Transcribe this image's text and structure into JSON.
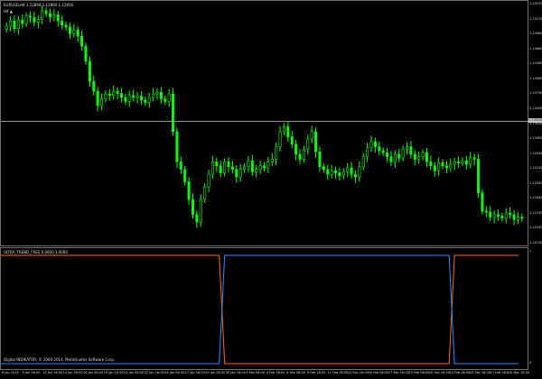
{
  "header": {
    "symbol_line": "EURUSD,H4  1.12894 1.12894 1.12856",
    "timeframe_label": "H4 ▲"
  },
  "indicator": {
    "label": "ULTRA_TREND_FREE 0.0000 1.0000",
    "scale_top": "1",
    "scale_bottom": "0"
  },
  "copyright": "Digital INDIKATOR, © 2000-2014, MetaQuotes Software Corp.",
  "current_price": "1.13206",
  "colors": {
    "background": "#000000",
    "bull_candle": "#00ff00",
    "bear_candle": "#00ff00",
    "grid_border": "#6e6e6e",
    "price_line": "#c8c8c8",
    "up_line": "#ff6a00",
    "down_line": "#1e90ff"
  },
  "price_ticks": [
    "1.15570",
    "1.15270",
    "1.14960",
    "1.14660",
    "1.14360",
    "1.14060",
    "1.13750",
    "1.13450",
    "1.13150",
    "1.12850",
    "1.12540",
    "1.12240",
    "1.11940",
    "1.11640",
    "1.11330",
    "1.11030",
    "1.10730"
  ],
  "time_ticks": [
    "8 Jan 2015",
    "9 Jan 08:00",
    "13 Jan 16:00",
    "14 Jan 16:00",
    "16 Jan 08:00",
    "19 Jan 16:00",
    "21 Jan 08:00",
    "22 Jan 16:00",
    "26 Jan 08:00",
    "27 Jan 16:00",
    "29 Jan 08:00",
    "30 Jan 16:00",
    "3 Feb 08:00",
    "4 Feb 16:00",
    "6 Feb 08:00",
    "9 Feb 16:00",
    "11 Feb 08:00",
    "12 Feb 16:00",
    "16 Feb 08:00",
    "17 Feb 16:00",
    "19 Feb 08:00",
    "20 Feb 16:00",
    "24 Feb 08:00",
    "25 Feb 16:00",
    "27 Feb 08:00",
    "2 Mar 16:00"
  ],
  "chart_data": {
    "type": "candlestick",
    "symbol": "EURUSD",
    "timeframe": "H4",
    "ylim": [
      1.107,
      1.156
    ],
    "close_series": [
      1.151,
      1.152,
      1.1505,
      1.1522,
      1.1515,
      1.153,
      1.1527,
      1.1518,
      1.1523,
      1.154,
      1.1535,
      1.1528,
      1.1532,
      1.152,
      1.1512,
      1.1508,
      1.1495,
      1.1502,
      1.149,
      1.147,
      1.144,
      1.14,
      1.138,
      1.1352,
      1.1365,
      1.1375,
      1.1372,
      1.138,
      1.1376,
      1.1368,
      1.136,
      1.1372,
      1.1368,
      1.137,
      1.1363,
      1.1358,
      1.1368,
      1.1375,
      1.1378,
      1.1365,
      1.136,
      1.1375,
      1.13,
      1.124,
      1.1225,
      1.12,
      1.1165,
      1.1135,
      1.112,
      1.1165,
      1.119,
      1.1215,
      1.124,
      1.1232,
      1.1218,
      1.124,
      1.123,
      1.1225,
      1.121,
      1.1225,
      1.123,
      1.1242,
      1.122,
      1.1225,
      1.1232,
      1.1228,
      1.124,
      1.1245,
      1.127,
      1.13,
      1.131,
      1.129,
      1.1275,
      1.1255,
      1.1245,
      1.1265,
      1.1285,
      1.13,
      1.126,
      1.123,
      1.1225,
      1.1215,
      1.1222,
      1.1218,
      1.1212,
      1.122,
      1.1228,
      1.1215,
      1.121,
      1.123,
      1.125,
      1.1268,
      1.128,
      1.127,
      1.1262,
      1.1258,
      1.125,
      1.124,
      1.1255,
      1.1248,
      1.1265,
      1.127,
      1.1255,
      1.1245,
      1.125,
      1.1258,
      1.124,
      1.1232,
      1.1222,
      1.1238,
      1.1232,
      1.1228,
      1.1235,
      1.124,
      1.1238,
      1.1242,
      1.1235,
      1.1248,
      1.1245,
      1.1178,
      1.1142,
      1.114,
      1.113,
      1.1135,
      1.1132,
      1.1128,
      1.1138,
      1.1135,
      1.1125,
      1.113,
      1.1128
    ],
    "current_price": 1.13206,
    "indicator_switch_points": [
      {
        "x": "~30 Jan",
        "to": "down"
      },
      {
        "x": "~24 Feb",
        "to": "up"
      }
    ]
  }
}
